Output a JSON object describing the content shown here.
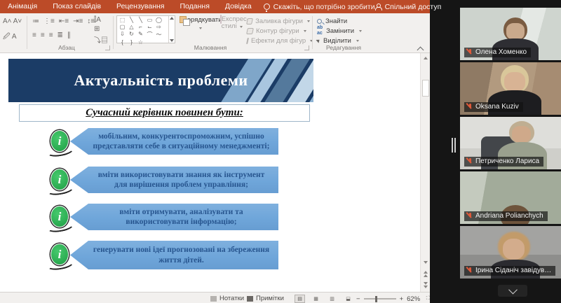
{
  "app": {
    "tabs": [
      "Анімація",
      "Показ слайдів",
      "Рецензування",
      "Подання",
      "Довідка"
    ],
    "tellme": "Скажіть, що потрібно зробити",
    "share_label": "Спільний доступ",
    "ribbon": {
      "group_paragraph": "Абзац",
      "group_drawing": "Малювання",
      "group_editing": "Редагування",
      "arrange": "Упорядкувати",
      "quick_styles": "Експрес-стилі",
      "shape_fill": "Заливка фігури",
      "shape_outline": "Контур фігури",
      "shape_effects": "Ефекти для фігур",
      "find": "Знайти",
      "replace": "Замінити",
      "select": "Виділити"
    },
    "statusbar": {
      "notes": "Нотатки",
      "comments": "Примітки",
      "zoom_level": "62%"
    }
  },
  "slide": {
    "title": "Актуальність проблеми",
    "subtitle": "Сучасний керівник повинен бути:",
    "bullets": [
      "мобільним, конкурентоспроможним, успішно представляти себе в ситуаційному менеджменті;",
      "вміти використовувати знання як інструмент для вирішення проблем управління;",
      "вміти отримувати, аналізувати та використовувати інформацію;",
      "генерувати нові ідеї прогнозовані на збереження життя дітей."
    ]
  },
  "participants": [
    {
      "name": "Олена Хоменко",
      "muted": true
    },
    {
      "name": "Oksana Kuziv",
      "muted": true
    },
    {
      "name": "Петриченко Лариса",
      "muted": true
    },
    {
      "name": "Andriana Polianchych",
      "muted": true
    },
    {
      "name": "Ірина Сіданіч завідув…",
      "muted": true
    }
  ]
}
